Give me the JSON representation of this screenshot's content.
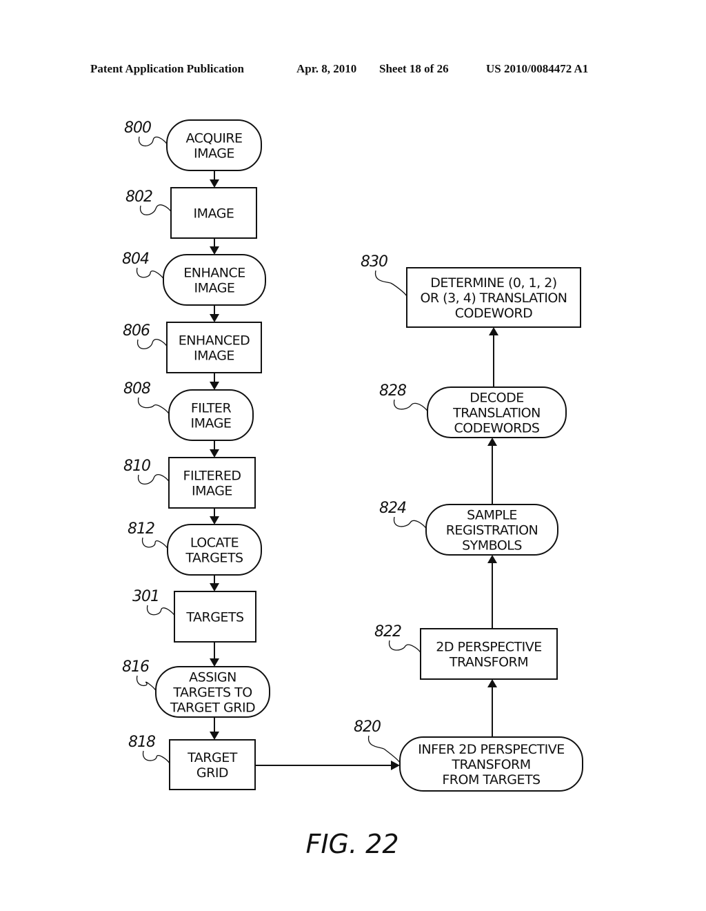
{
  "header": {
    "publication": "Patent Application Publication",
    "date": "Apr. 8, 2010",
    "sheet": "Sheet 18 of 26",
    "number": "US 2010/0084472 A1"
  },
  "figure": {
    "caption": "FIG. 22",
    "nodes": [
      {
        "id": "800",
        "shape": "rounded",
        "lines": [
          "ACQUIRE",
          "IMAGE"
        ]
      },
      {
        "id": "802",
        "shape": "rect",
        "lines": [
          "IMAGE"
        ]
      },
      {
        "id": "804",
        "shape": "rounded",
        "lines": [
          "ENHANCE",
          "IMAGE"
        ]
      },
      {
        "id": "806",
        "shape": "rect",
        "lines": [
          "ENHANCED",
          "IMAGE"
        ]
      },
      {
        "id": "808",
        "shape": "rounded",
        "lines": [
          "FILTER",
          "IMAGE"
        ]
      },
      {
        "id": "810",
        "shape": "rect",
        "lines": [
          "FILTERED",
          "IMAGE"
        ]
      },
      {
        "id": "812",
        "shape": "rounded",
        "lines": [
          "LOCATE",
          "TARGETS"
        ]
      },
      {
        "id": "301",
        "shape": "rect",
        "lines": [
          "TARGETS"
        ]
      },
      {
        "id": "816",
        "shape": "rounded",
        "lines": [
          "ASSIGN",
          "TARGETS TO",
          "TARGET GRID"
        ]
      },
      {
        "id": "818",
        "shape": "rect",
        "lines": [
          "TARGET",
          "GRID"
        ]
      },
      {
        "id": "820",
        "shape": "rounded",
        "lines": [
          "INFER 2D PERSPECTIVE",
          "TRANSFORM",
          "FROM TARGETS"
        ]
      },
      {
        "id": "822",
        "shape": "rect",
        "lines": [
          "2D PERSPECTIVE",
          "TRANSFORM"
        ]
      },
      {
        "id": "824",
        "shape": "rounded",
        "lines": [
          "SAMPLE",
          "REGISTRATION",
          "SYMBOLS"
        ]
      },
      {
        "id": "828",
        "shape": "rounded",
        "lines": [
          "DECODE",
          "TRANSLATION",
          "CODEWORDS"
        ]
      },
      {
        "id": "830",
        "shape": "rect",
        "lines": [
          "DETERMINE (0, 1, 2)",
          "OR (3, 4) TRANSLATION",
          "CODEWORD"
        ]
      }
    ],
    "edges": [
      {
        "from": "800",
        "to": "802"
      },
      {
        "from": "802",
        "to": "804"
      },
      {
        "from": "804",
        "to": "806"
      },
      {
        "from": "806",
        "to": "808"
      },
      {
        "from": "808",
        "to": "810"
      },
      {
        "from": "810",
        "to": "812"
      },
      {
        "from": "812",
        "to": "301"
      },
      {
        "from": "301",
        "to": "816"
      },
      {
        "from": "816",
        "to": "818"
      },
      {
        "from": "818",
        "to": "820"
      },
      {
        "from": "820",
        "to": "822"
      },
      {
        "from": "822",
        "to": "824"
      },
      {
        "from": "824",
        "to": "828"
      },
      {
        "from": "828",
        "to": "830"
      }
    ]
  }
}
